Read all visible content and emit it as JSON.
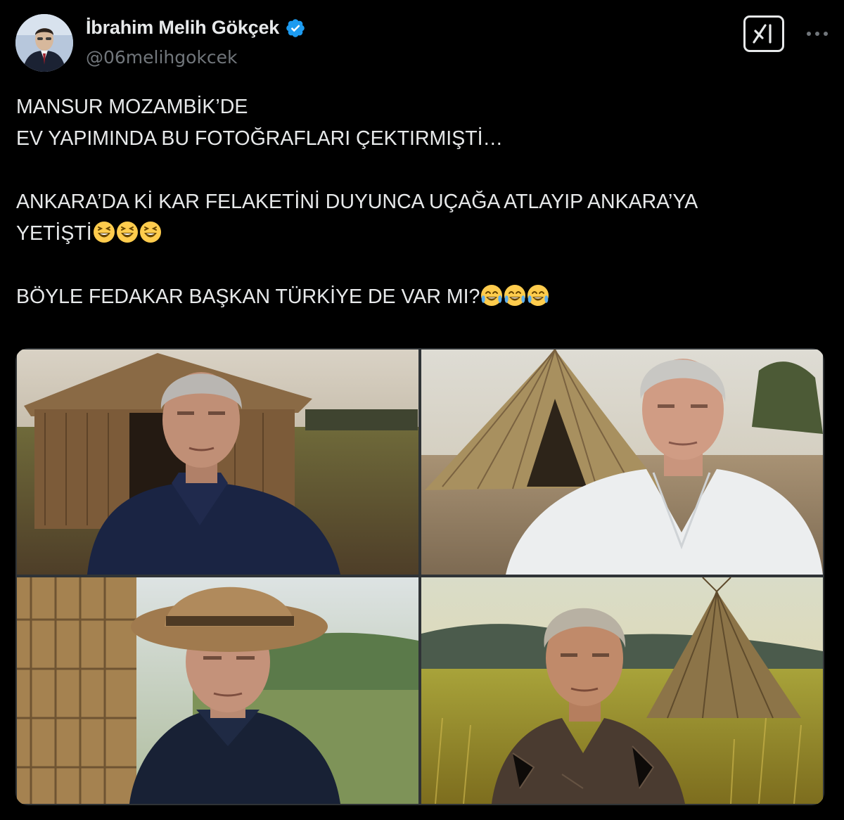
{
  "author": {
    "display_name": "İbrahim Melih Gökçek",
    "handle": "@06melihgokcek",
    "verified": true,
    "verified_color": "#1d9bf0",
    "avatar_icon": "profile-photo"
  },
  "header_actions": {
    "grok_icon": "grok-icon",
    "more_icon": "more-horizontal-icon"
  },
  "tweet": {
    "lines": [
      "MANSUR MOZAMBİK’DE",
      "EV YAPIMINDA BU FOTOĞRAFLARI ÇEKTIRMIŞTİ…",
      "ANKARA’DA Kİ KAR FELAKETİNİ DUYUNCA UÇAĞA ATLAYIP ANKARA’YA",
      "YETİŞTİ",
      "BÖYLE FEDAKAR BAŞKAN TÜRKİYE DE VAR MI?"
    ],
    "emoji_line4": [
      "laughing-emoji",
      "laughing-emoji",
      "laughing-emoji"
    ],
    "emoji_line5": [
      "tears-of-joy-emoji",
      "tears-of-joy-emoji",
      "tears-of-joy-emoji"
    ]
  },
  "media": {
    "photos": [
      {
        "subject": "man in navy shirt in front of thatched hut"
      },
      {
        "subject": "man in white embroidered shirt beside reed hut"
      },
      {
        "subject": "man in straw hat near woven reeds"
      },
      {
        "subject": "man in patterned shirt in golden grass field at sunset"
      }
    ]
  },
  "colors": {
    "background": "#000000",
    "text": "#e7e9ea",
    "secondary_text": "#71767b",
    "accent": "#1d9bf0"
  }
}
